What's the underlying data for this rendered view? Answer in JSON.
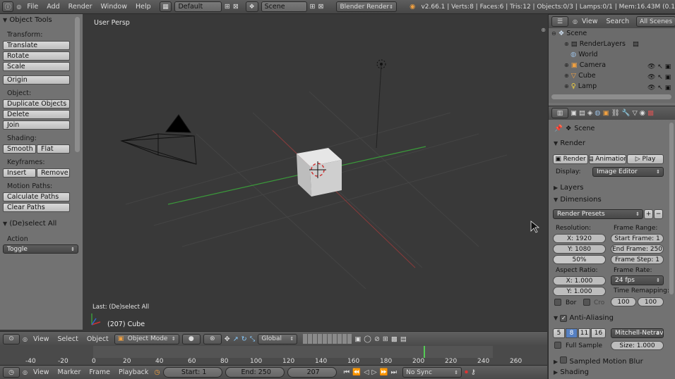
{
  "topbar": {
    "menus": [
      "File",
      "Add",
      "Render",
      "Window",
      "Help"
    ],
    "layout_value": "Default",
    "scene_value": "Scene",
    "engine_value": "Blender Render",
    "stats": "v2.66.1 | Verts:8 | Faces:6 | Tris:12 | Objects:0/3 | Lamps:0/1 | Mem:16.43M (0.1"
  },
  "toolshelf": {
    "title": "Object Tools",
    "transform_label": "Transform:",
    "translate": "Translate",
    "rotate": "Rotate",
    "scale": "Scale",
    "origin": "Origin",
    "object_label": "Object:",
    "duplicate": "Duplicate Objects",
    "delete": "Delete",
    "join": "Join",
    "shading_label": "Shading:",
    "smooth": "Smooth",
    "flat": "Flat",
    "keyframes_label": "Keyframes:",
    "insert": "Insert",
    "remove": "Remove",
    "motion_label": "Motion Paths:",
    "calc_paths": "Calculate Paths",
    "clear_paths": "Clear Paths",
    "deselect_title": "(De)select All",
    "action_label": "Action",
    "action_value": "Toggle"
  },
  "viewport": {
    "view_name": "User Persp",
    "last_op": "Last: (De)select All",
    "object_info": "(207) Cube"
  },
  "view3d_header": {
    "menus": [
      "View",
      "Select",
      "Object"
    ],
    "mode": "Object Mode",
    "orientation": "Global"
  },
  "timeline_ruler": {
    "ticks": [
      "-40",
      "-20",
      "0",
      "20",
      "40",
      "60",
      "80",
      "100",
      "120",
      "140",
      "160",
      "180",
      "200",
      "220",
      "240",
      "260"
    ]
  },
  "timeline_header": {
    "menus": [
      "View",
      "Marker",
      "Frame",
      "Playback"
    ],
    "start": "Start: 1",
    "end": "End: 250",
    "current": "207",
    "sync": "No Sync"
  },
  "outliner": {
    "view": "View",
    "search": "Search",
    "filter": "All Scenes",
    "items": [
      "Scene",
      "RenderLayers",
      "World",
      "Camera",
      "Cube",
      "Lamp"
    ]
  },
  "properties": {
    "context": "Scene",
    "render_title": "Render",
    "render_btn": "Render",
    "animation_btn": "Animation",
    "play_btn": "Play",
    "display_label": "Display:",
    "display_value": "Image Editor",
    "layers_title": "Layers",
    "dimensions_title": "Dimensions",
    "render_presets": "Render Presets",
    "resolution_label": "Resolution:",
    "res_x": "X: 1920",
    "res_y": "Y: 1080",
    "res_pct": "50%",
    "frame_range_label": "Frame Range:",
    "start_frame": "Start Frame: 1",
    "end_frame": "End Frame: 250",
    "frame_step": "Frame Step: 1",
    "aspect_label": "Aspect Ratio:",
    "aspect_x": "X: 1.000",
    "aspect_y": "Y: 1.000",
    "frame_rate_label": "Frame Rate:",
    "frame_rate": "24 fps",
    "time_remap_label": "Time Remapping:",
    "remap_old": "100",
    "remap_new": "100",
    "border": "Bor",
    "crop": "Cro",
    "aa_title": "Anti-Aliasing",
    "aa_samples": [
      "5",
      "8",
      "11",
      "16"
    ],
    "aa_filter": "Mitchell-Netrav",
    "full_sample": "Full Sample",
    "aa_size": "Size: 1.000",
    "motion_blur_title": "Sampled Motion Blur",
    "shading_title": "Shading"
  }
}
